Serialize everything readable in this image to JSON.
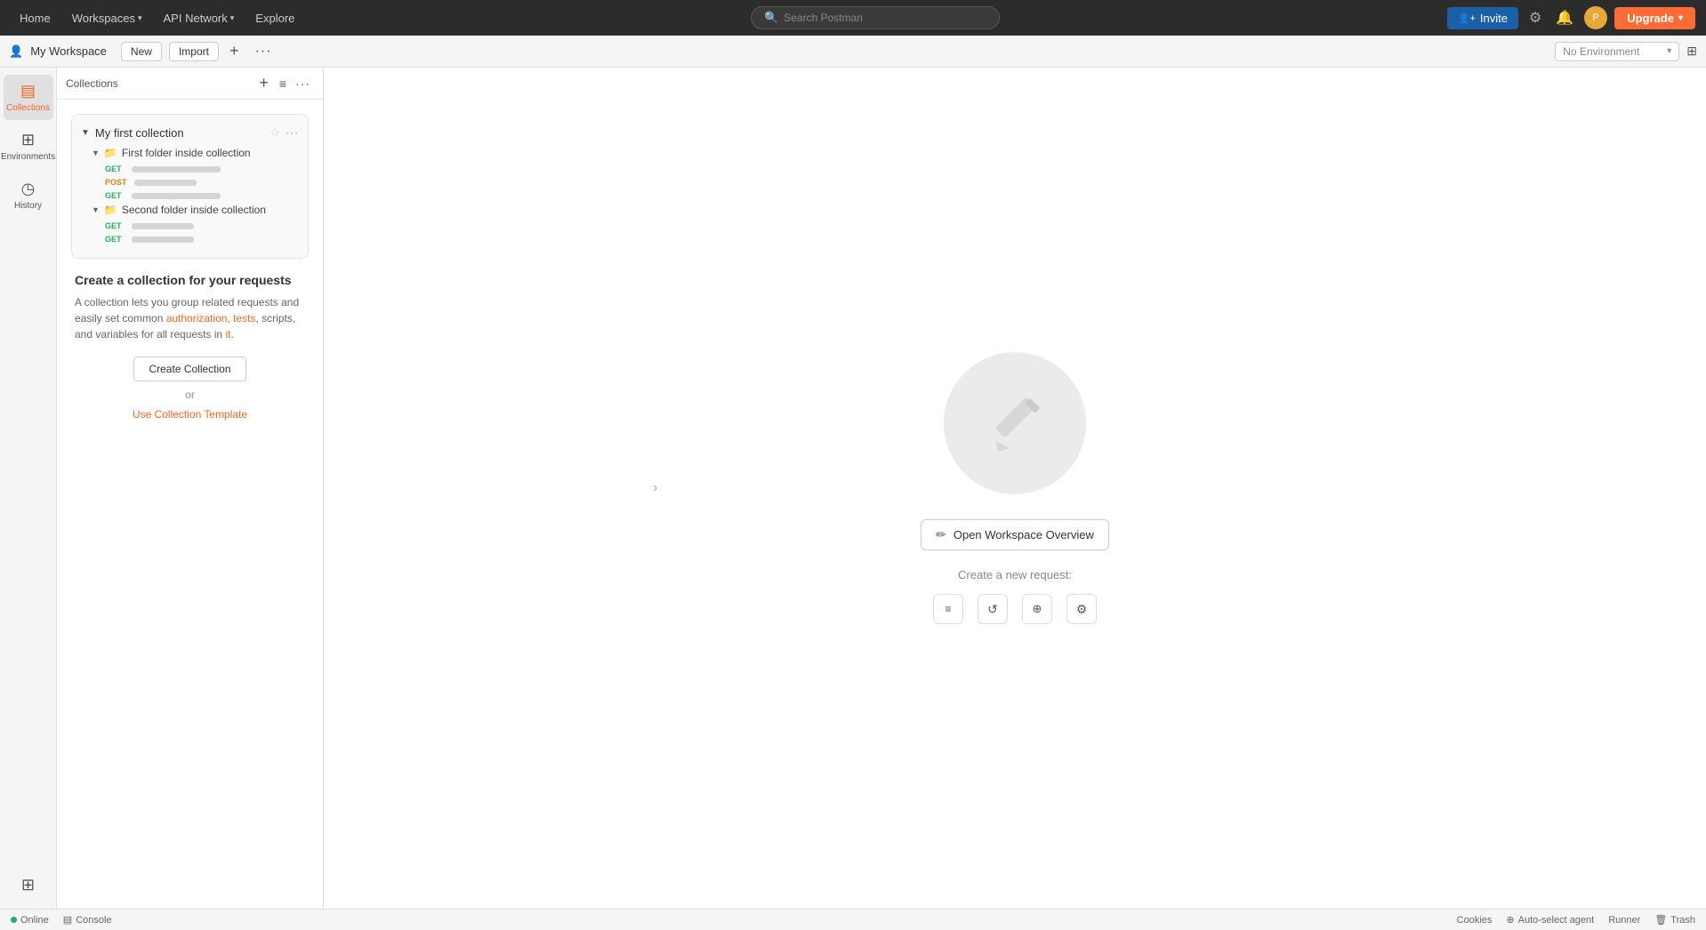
{
  "topnav": {
    "items": [
      {
        "label": "Home",
        "id": "home",
        "hasArrow": false
      },
      {
        "label": "Workspaces",
        "id": "workspaces",
        "hasArrow": true
      },
      {
        "label": "API Network",
        "id": "api-network",
        "hasArrow": true
      },
      {
        "label": "Explore",
        "id": "explore",
        "hasArrow": false
      }
    ],
    "search_placeholder": "Search Postman",
    "invite_label": "Invite",
    "upgrade_label": "Upgrade"
  },
  "workspace_bar": {
    "workspace_name": "My Workspace",
    "new_label": "New",
    "import_label": "Import",
    "env_placeholder": "No Environment"
  },
  "sidebar": {
    "items": [
      {
        "id": "collections",
        "label": "Collections",
        "icon": "▤"
      },
      {
        "id": "environments",
        "label": "Environments",
        "icon": "⊞"
      },
      {
        "id": "history",
        "label": "History",
        "icon": "◷"
      }
    ],
    "apps_icon": "⊞"
  },
  "panel": {
    "title": "Collections",
    "collection": {
      "name": "My first collection",
      "folders": [
        {
          "name": "First folder inside collection",
          "requests": [
            {
              "method": "GET",
              "wide": true
            },
            {
              "method": "POST",
              "wide": false
            },
            {
              "method": "GET",
              "wide": true
            }
          ]
        },
        {
          "name": "Second folder inside collection",
          "requests": [
            {
              "method": "GET",
              "wide": false
            },
            {
              "method": "GET",
              "wide": false
            }
          ]
        }
      ]
    },
    "create_title": "Create a collection for your requests",
    "create_desc_part1": "A collection lets you group related requests and easily set common ",
    "create_desc_link1": "authorization",
    "create_desc_part2": ", ",
    "create_desc_link2": "tests",
    "create_desc_part3": ", scripts, and variables for all requests in ",
    "create_desc_link3": "it",
    "create_desc_part4": ".",
    "create_collection_label": "Create Collection",
    "or_label": "or",
    "template_label": "Use Collection Template"
  },
  "main": {
    "open_workspace_label": "Open Workspace Overview",
    "create_request_label": "Create a new request:",
    "request_icons": [
      "▤",
      "↺",
      "⊕",
      "⚙"
    ]
  },
  "statusbar": {
    "online_label": "Online",
    "console_label": "Console",
    "cookies_label": "Cookies",
    "autoselect_label": "Auto-select agent",
    "runner_label": "Runner",
    "trash_label": "Trash"
  }
}
